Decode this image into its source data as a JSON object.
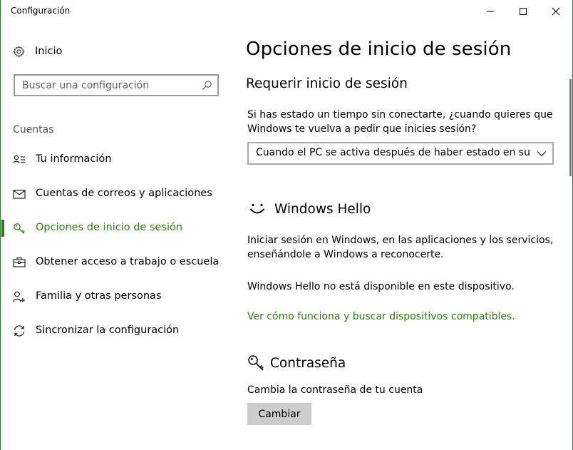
{
  "window": {
    "title": "Configuración",
    "controls": {
      "minimize": "minimize",
      "maximize": "maximize",
      "close": "close"
    }
  },
  "sidebar": {
    "home_label": "Inicio",
    "search_placeholder": "Buscar una configuración",
    "section_label": "Cuentas",
    "items": [
      {
        "label": "Tu información",
        "icon": "person-card-icon",
        "active": false
      },
      {
        "label": "Cuentas de correos y aplicaciones",
        "icon": "mail-icon",
        "active": false
      },
      {
        "label": "Opciones de inicio de sesión",
        "icon": "key-icon",
        "active": true
      },
      {
        "label": "Obtener acceso a trabajo o escuela",
        "icon": "briefcase-icon",
        "active": false
      },
      {
        "label": "Familia y otras personas",
        "icon": "person-add-icon",
        "active": false
      },
      {
        "label": "Sincronizar la configuración",
        "icon": "sync-icon",
        "active": false
      }
    ]
  },
  "main": {
    "title": "Opciones de inicio de sesión",
    "require_signin": {
      "heading": "Requerir inicio de sesión",
      "description_line1": "Si has estado un tiempo sin conectarte, ¿cuando quieres que",
      "description_line2": "Windows te vuelva a pedir que inicies sesión?",
      "dropdown_value": "Cuando el PC se activa después de haber estado en susp..."
    },
    "hello": {
      "heading": "Windows Hello",
      "description_line1": "Iniciar sesión en Windows, en las aplicaciones y los servicios,",
      "description_line2": "enseñándole a Windows a reconocerte.",
      "unavailable": "Windows Hello no está disponible en este dispositivo.",
      "link": "Ver cómo funciona y buscar dispositivos compatibles."
    },
    "password": {
      "heading": "Contraseña",
      "description": "Cambia la contraseña de tu cuenta",
      "button": "Cambiar"
    }
  },
  "colors": {
    "accent": "#2d7d12",
    "button_bg": "#cccccc",
    "border": "#a9a9a9"
  }
}
